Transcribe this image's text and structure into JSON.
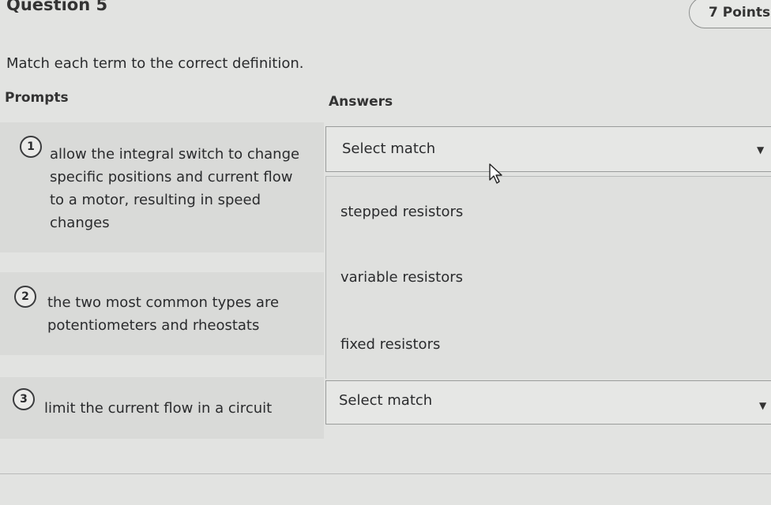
{
  "question": {
    "title": "Question 5",
    "points": "7 Points"
  },
  "instruction": "Match each term to the correct definition.",
  "columns": {
    "prompts": "Prompts",
    "answers": "Answers"
  },
  "prompts": [
    {
      "number": "1",
      "lines": [
        "allow the integral switch to change",
        "specific positions and current flow",
        "to a motor, resulting in speed",
        "changes"
      ]
    },
    {
      "number": "2",
      "lines": [
        "the two most common types are",
        "potentiometers and rheostats"
      ]
    },
    {
      "number": "3",
      "lines": [
        "limit the current flow in a circuit"
      ]
    }
  ],
  "selects": [
    {
      "value": "Select match",
      "expanded": true
    },
    {
      "value": "Select match",
      "expanded": false
    }
  ],
  "dropdown_options": [
    "stepped resistors",
    "variable resistors",
    "fixed resistors"
  ],
  "icons": {
    "caret": "caret-down-icon",
    "cursor": "mouse-pointer-icon"
  }
}
